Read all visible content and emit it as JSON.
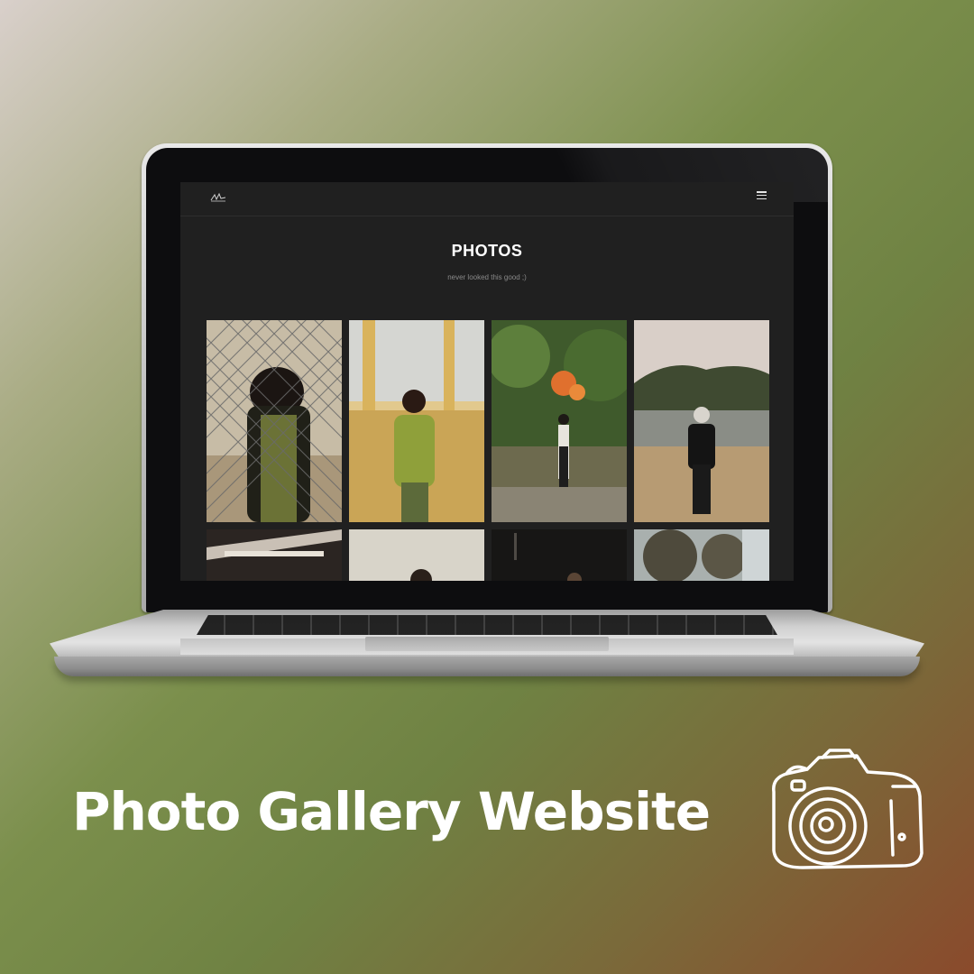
{
  "website": {
    "page_title": "PHOTOS",
    "page_subtitle": "never looked this good ;)"
  },
  "icons": {
    "logo": "signature-logo-icon",
    "menu": "hamburger-menu-icon",
    "camera": "camera-icon"
  },
  "caption": "Photo Gallery Website",
  "colors": {
    "screen_bg": "#202020",
    "title": "#ffffff",
    "subtitle": "#8a8a8a"
  }
}
